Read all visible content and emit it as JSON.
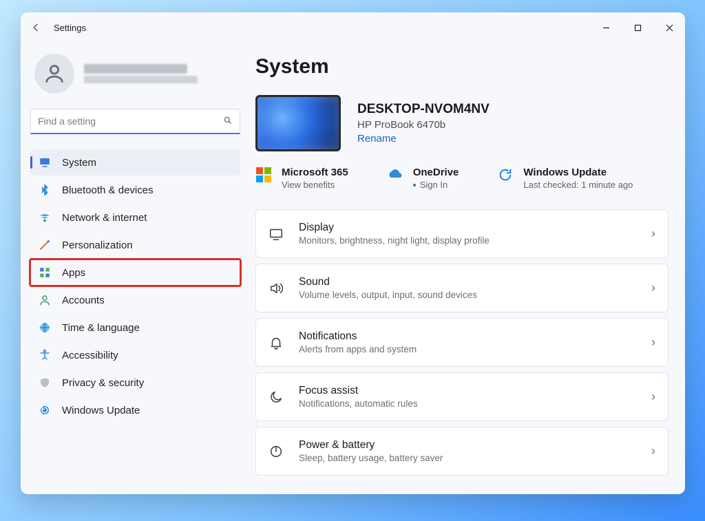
{
  "window": {
    "title": "Settings",
    "search_placeholder": "Find a setting"
  },
  "sidebar": {
    "items": [
      {
        "label": "System",
        "icon": "monitor",
        "selected": true,
        "highlighted": false
      },
      {
        "label": "Bluetooth & devices",
        "icon": "bluetooth",
        "selected": false,
        "highlighted": false
      },
      {
        "label": "Network & internet",
        "icon": "wifi",
        "selected": false,
        "highlighted": false
      },
      {
        "label": "Personalization",
        "icon": "brush",
        "selected": false,
        "highlighted": false
      },
      {
        "label": "Apps",
        "icon": "apps",
        "selected": false,
        "highlighted": true
      },
      {
        "label": "Accounts",
        "icon": "person",
        "selected": false,
        "highlighted": false
      },
      {
        "label": "Time & language",
        "icon": "globe",
        "selected": false,
        "highlighted": false
      },
      {
        "label": "Accessibility",
        "icon": "access",
        "selected": false,
        "highlighted": false
      },
      {
        "label": "Privacy & security",
        "icon": "shield",
        "selected": false,
        "highlighted": false
      },
      {
        "label": "Windows Update",
        "icon": "update",
        "selected": false,
        "highlighted": false
      }
    ]
  },
  "main": {
    "heading": "System",
    "device": {
      "name": "DESKTOP-NVOM4NV",
      "model": "HP ProBook 6470b",
      "rename_label": "Rename"
    },
    "cloud": {
      "m365": {
        "title": "Microsoft 365",
        "sub": "View benefits"
      },
      "onedrive": {
        "title": "OneDrive",
        "sub": "Sign In"
      },
      "update": {
        "title": "Windows Update",
        "sub": "Last checked: 1 minute ago"
      }
    },
    "settings": [
      {
        "icon": "display",
        "title": "Display",
        "sub": "Monitors, brightness, night light, display profile"
      },
      {
        "icon": "sound",
        "title": "Sound",
        "sub": "Volume levels, output, input, sound devices"
      },
      {
        "icon": "bell",
        "title": "Notifications",
        "sub": "Alerts from apps and system"
      },
      {
        "icon": "moon",
        "title": "Focus assist",
        "sub": "Notifications, automatic rules"
      },
      {
        "icon": "power",
        "title": "Power & battery",
        "sub": "Sleep, battery usage, battery saver"
      }
    ]
  }
}
